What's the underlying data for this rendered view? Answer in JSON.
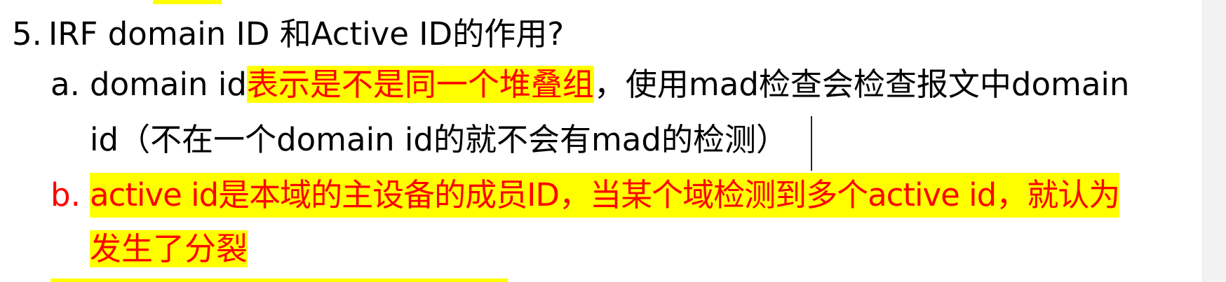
{
  "colors": {
    "highlight": "#ffff00",
    "emphasis_text": "#ff0000",
    "body_text": "#000000"
  },
  "question": {
    "number": "5.",
    "text": "IRF domain ID 和Active ID的作用?"
  },
  "item_a": {
    "marker": "a.",
    "plain_start": "domain id",
    "highlighted": "表示是不是同一个堆叠组",
    "rest_line1": "，使用mad检查会检查报文中domain",
    "line2": "id（不在一个domain id的就不会有mad的检测）"
  },
  "item_b": {
    "marker": "b.",
    "line1": "active id是本域的主设备的成员ID，当某个域检测到多个active id，就认为",
    "line2": "发生了分裂"
  }
}
